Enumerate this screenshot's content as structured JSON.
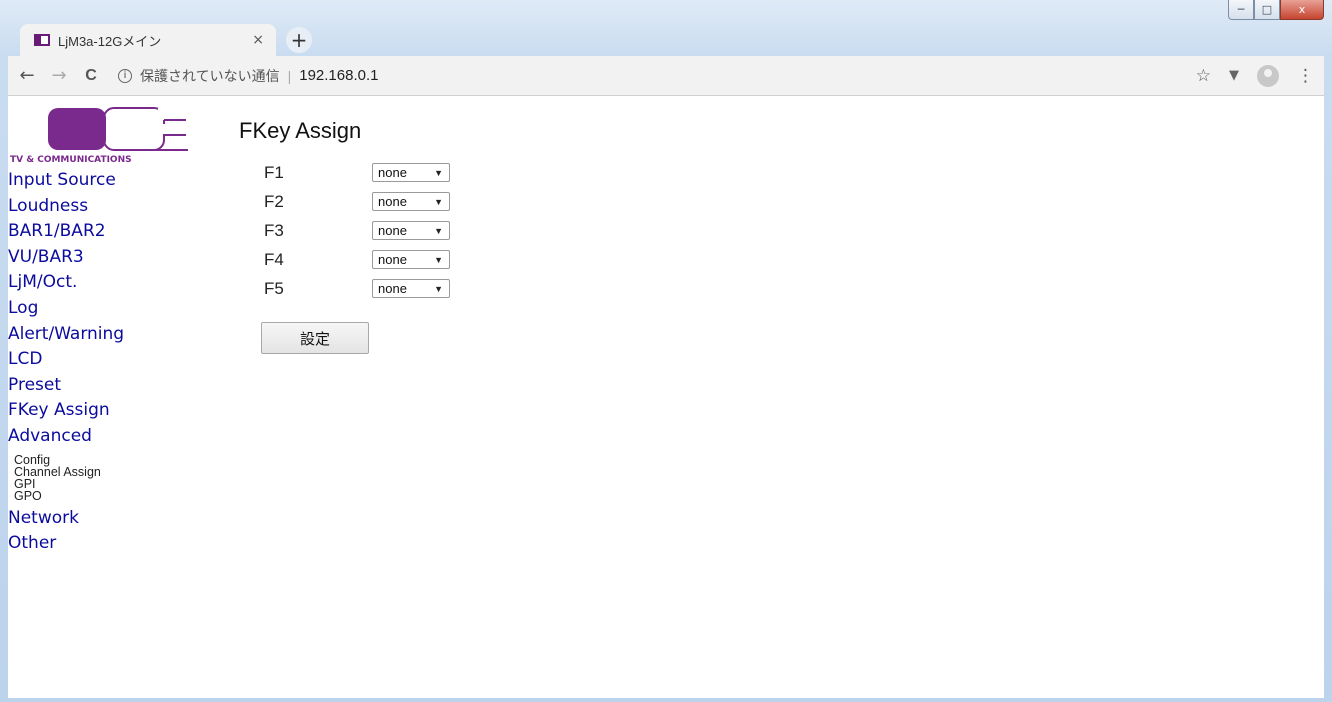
{
  "browser": {
    "tab_title": "LjM3a-12Gメイン",
    "tab_close": "×",
    "new_tab": "+",
    "back": "←",
    "forward": "→",
    "reload": "C",
    "security_text": "保護されていない通信",
    "separator": "|",
    "url": "192.168.0.1",
    "bookmark_star": "☆",
    "extension": "▼",
    "menu": "⋮"
  },
  "window": {
    "minimize": "─",
    "maximize": "□",
    "close": "x"
  },
  "logo": {
    "tagline": "TV & COMMUNICATIONS"
  },
  "nav": {
    "items": [
      "Input Source",
      "Loudness",
      "BAR1/BAR2",
      "VU/BAR3",
      "LjM/Oct.",
      "Log",
      "Alert/Warning",
      "LCD",
      "Preset",
      "FKey Assign",
      "Advanced"
    ],
    "advanced_sub": [
      "Config",
      "Channel Assign",
      "GPI",
      "GPO"
    ],
    "after": [
      "Network",
      "Other"
    ]
  },
  "main": {
    "title": "FKey Assign",
    "rows": [
      {
        "label": "F1",
        "value": "none"
      },
      {
        "label": "F2",
        "value": "none"
      },
      {
        "label": "F3",
        "value": "none"
      },
      {
        "label": "F4",
        "value": "none"
      },
      {
        "label": "F5",
        "value": "none"
      }
    ],
    "submit_label": "設定"
  },
  "colors": {
    "nav_link": "#0b0b9e",
    "logo_purple": "#7a2a8c"
  }
}
